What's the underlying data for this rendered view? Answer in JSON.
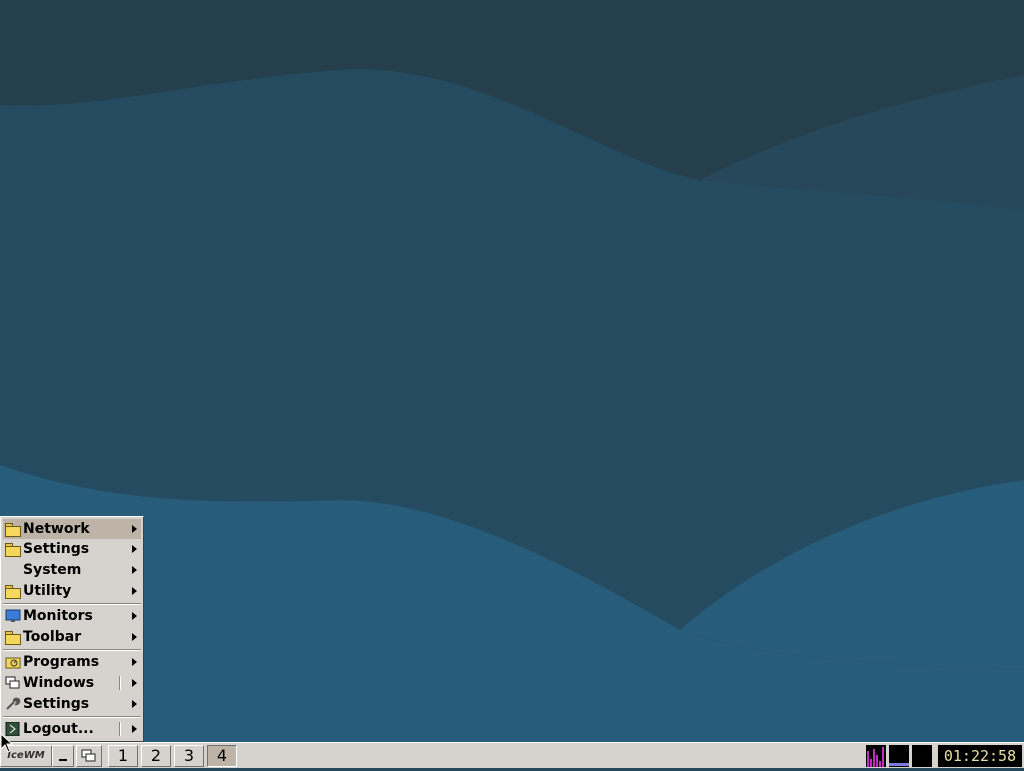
{
  "colors": {
    "desktop_dark": "#24475a",
    "desktop_mid": "#244b60",
    "desktop_light": "#2a5f7e",
    "menu_bg": "#d6d3ce",
    "menu_active": "#bdb4a7",
    "clock_fg": "#e8e0a0"
  },
  "start_menu": {
    "items": [
      {
        "label": "Network",
        "icon": "folder-icon",
        "active": true
      },
      {
        "label": "Settings",
        "icon": "folder-icon"
      },
      {
        "label": "System",
        "icon": ""
      },
      {
        "label": "Utility",
        "icon": "folder-icon"
      },
      {
        "label": "Monitors",
        "icon": "monitor-icon"
      },
      {
        "label": "Toolbar",
        "icon": "folder-icon"
      },
      {
        "label": "Programs",
        "icon": "programs-icon"
      },
      {
        "label": "Windows",
        "icon": "windows-icon"
      },
      {
        "label": "Settings",
        "icon": "wrench-icon"
      },
      {
        "label": "Logout...",
        "icon": "logout-icon"
      }
    ]
  },
  "taskbar": {
    "start_label": "IceWM",
    "workspaces": [
      "1",
      "2",
      "3",
      "4"
    ],
    "active_workspace": "4",
    "clock": "01:22:58"
  }
}
